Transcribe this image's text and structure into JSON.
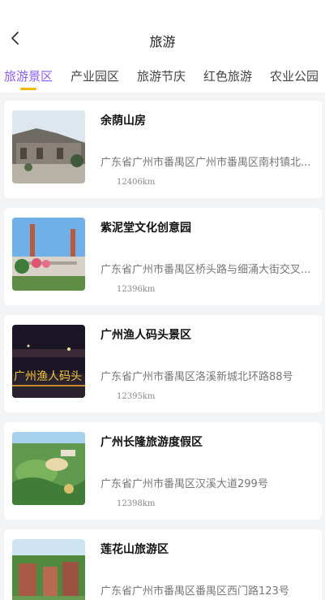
{
  "header": {
    "title": "旅游",
    "back_icon": "chevron-left-icon"
  },
  "tabs": [
    {
      "label": "旅游景区",
      "active": true
    },
    {
      "label": "产业园区",
      "active": false
    },
    {
      "label": "旅游节庆",
      "active": false
    },
    {
      "label": "红色旅游",
      "active": false
    },
    {
      "label": "农业公园",
      "active": false
    }
  ],
  "colors": {
    "active_tab": "#8b5cf6",
    "indicator": "#f5b800",
    "background": "#f3f4f6"
  },
  "spots": [
    {
      "name": "余荫山房",
      "address": "广东省广州市番禺区广州市番禺区南村镇北...",
      "distance": "12406km"
    },
    {
      "name": "紫泥堂文化创意园",
      "address": "广东省广州市番禺区桥头路与细涌大街交叉...",
      "distance": "12396km"
    },
    {
      "name": "广州渔人码头景区",
      "address": "广东省广州市番禺区洛溪新城北环路88号",
      "distance": "12395km",
      "image_text": "广州渔人码头"
    },
    {
      "name": "广州长隆旅游度假区",
      "address": "广东省广州市番禺区汉溪大道299号",
      "distance": "12398km"
    },
    {
      "name": "莲花山旅游区",
      "address": "广东省广州市番禺区番禺区西门路123号",
      "distance": ""
    }
  ]
}
